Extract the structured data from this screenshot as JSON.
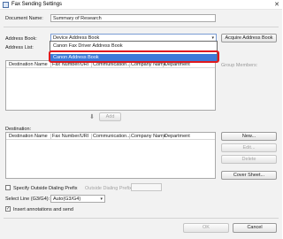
{
  "window": {
    "title": "Fax Sending Settings",
    "close_glyph": "✕"
  },
  "document_name": {
    "label": "Document Name:",
    "value": "Summary of Research"
  },
  "address_book": {
    "label": "Address Book:",
    "selected": "Device Address Book",
    "options": [
      "Canon Fax Driver Address Book",
      "Canon Address Book"
    ],
    "acquire_button": "Acquire Address Book"
  },
  "address_list": {
    "label": "Address List:",
    "columns": [
      "Destination Name",
      "Fax Number/URI",
      "Communication...",
      "Company Name",
      "Department"
    ]
  },
  "group_members_label": "Group Members:",
  "add_button": "Add",
  "destination": {
    "label": "Destination:",
    "columns": [
      "Destination Name",
      "Fax Number/URI",
      "Communication...",
      "Company Name",
      "Department"
    ],
    "buttons": {
      "new": "New...",
      "edit": "Edit...",
      "delete": "Delete",
      "cover_sheet": "Cover Sheet..."
    }
  },
  "outside_dialing": {
    "checkbox_label": "Specify Outside Dialing Prefix",
    "prefix_label": "Outside Dialing Prefix:",
    "prefix_value": ""
  },
  "select_line": {
    "label": "Select Line (G3/G4):",
    "value": "Auto(G3/G4)"
  },
  "insert_annotations": {
    "label": "Insert annotations and send",
    "checked_glyph": "✓"
  },
  "footer": {
    "ok": "OK",
    "cancel": "Cancel"
  },
  "colors": {
    "selection": "#3d7ad8",
    "highlight_border": "#e0191e"
  }
}
